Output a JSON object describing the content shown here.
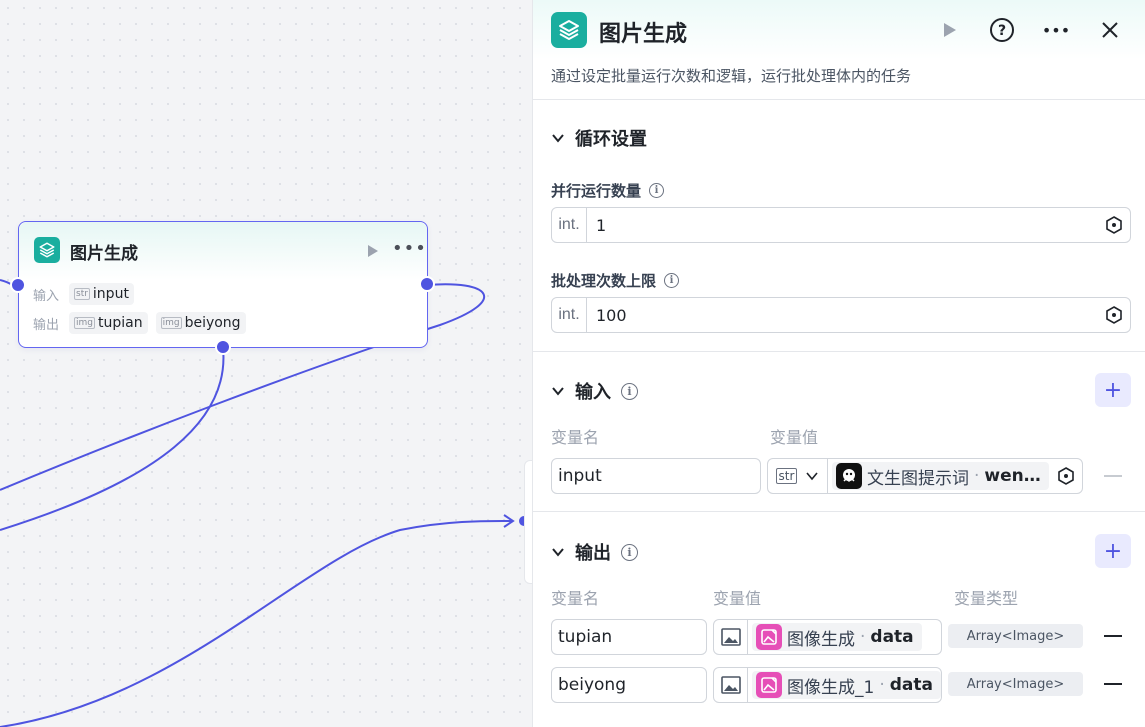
{
  "node": {
    "title": "图片生成",
    "input_label": "输入",
    "output_label": "输出",
    "input_vars": [
      {
        "type": "str",
        "name": "input"
      }
    ],
    "output_vars": [
      {
        "type": "img",
        "name": "tupian"
      },
      {
        "type": "img",
        "name": "beiyong"
      }
    ]
  },
  "panel": {
    "title": "图片生成",
    "description": "通过设定批量运行次数和逻辑，运行批处理体内的任务",
    "loop_section": {
      "title": "循环设置",
      "parallel": {
        "label": "并行运行数量",
        "prefix": "int.",
        "value": "1"
      },
      "batch_limit": {
        "label": "批处理次数上限",
        "prefix": "int.",
        "value": "100"
      }
    },
    "input_section": {
      "title": "输入",
      "col_name": "变量名",
      "col_value": "变量值",
      "rows": [
        {
          "name": "input",
          "type": "str",
          "ref_label": "文生图提示词",
          "ref_field": "wen…"
        }
      ]
    },
    "output_section": {
      "title": "输出",
      "col_name": "变量名",
      "col_value": "变量值",
      "col_type": "变量类型",
      "rows": [
        {
          "name": "tupian",
          "ref_label": "图像生成",
          "ref_field": "data",
          "var_type": "Array<Image>"
        },
        {
          "name": "beiyong",
          "ref_label": "图像生成_1",
          "ref_field": "data",
          "var_type": "Array<Image>"
        }
      ]
    }
  },
  "colors": {
    "accent": "#4f54e0",
    "node_icon": "#1aae9f",
    "image_app": "#e64fb7"
  },
  "icons": [
    "layers-icon",
    "play-icon",
    "help-icon",
    "more-icon",
    "close-icon",
    "chevron-down-icon",
    "info-icon",
    "stepper-icon",
    "plus-icon",
    "minus-icon",
    "image-icon",
    "robot-icon"
  ]
}
